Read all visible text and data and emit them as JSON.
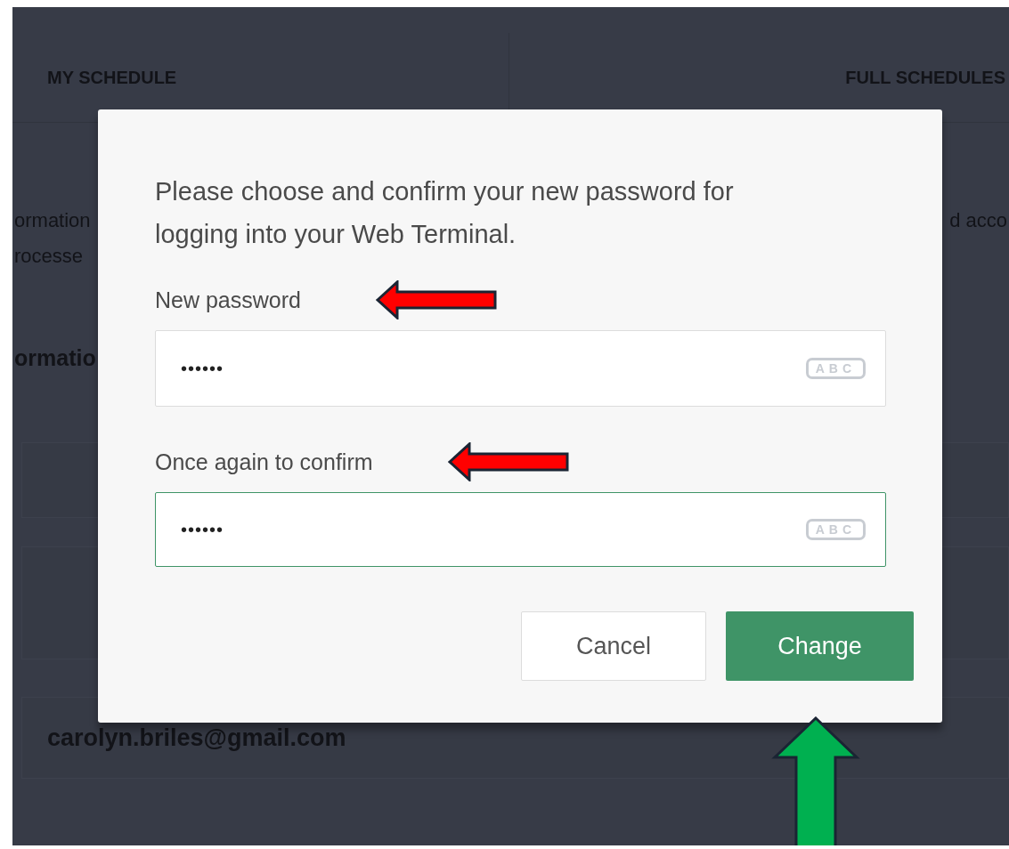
{
  "background": {
    "tabs": [
      {
        "label": "MY SCHEDULE"
      },
      {
        "label": "FULL SCHEDULES"
      }
    ],
    "paragraph_left": [
      "ormation",
      "rocesse"
    ],
    "paragraph_right": "d acco",
    "section_heading": "ormatio",
    "email": "carolyn.briles@gmail.com"
  },
  "dialog": {
    "message": "Please choose and confirm your new password for logging into your Web Terminal.",
    "fields": [
      {
        "label": "New password",
        "value": "••••••",
        "focused": false,
        "toggle": "ABC"
      },
      {
        "label": "Once again to confirm",
        "value": "••••••",
        "focused": true,
        "toggle": "ABC"
      }
    ],
    "buttons": [
      {
        "label": "Cancel",
        "kind": "secondary"
      },
      {
        "label": "Change",
        "kind": "primary"
      }
    ]
  },
  "annotations": [
    {
      "kind": "leftarrow",
      "color": "#ff0000"
    },
    {
      "kind": "leftarrow",
      "color": "#ff0000"
    },
    {
      "kind": "uparrow",
      "color": "#00b050"
    }
  ]
}
